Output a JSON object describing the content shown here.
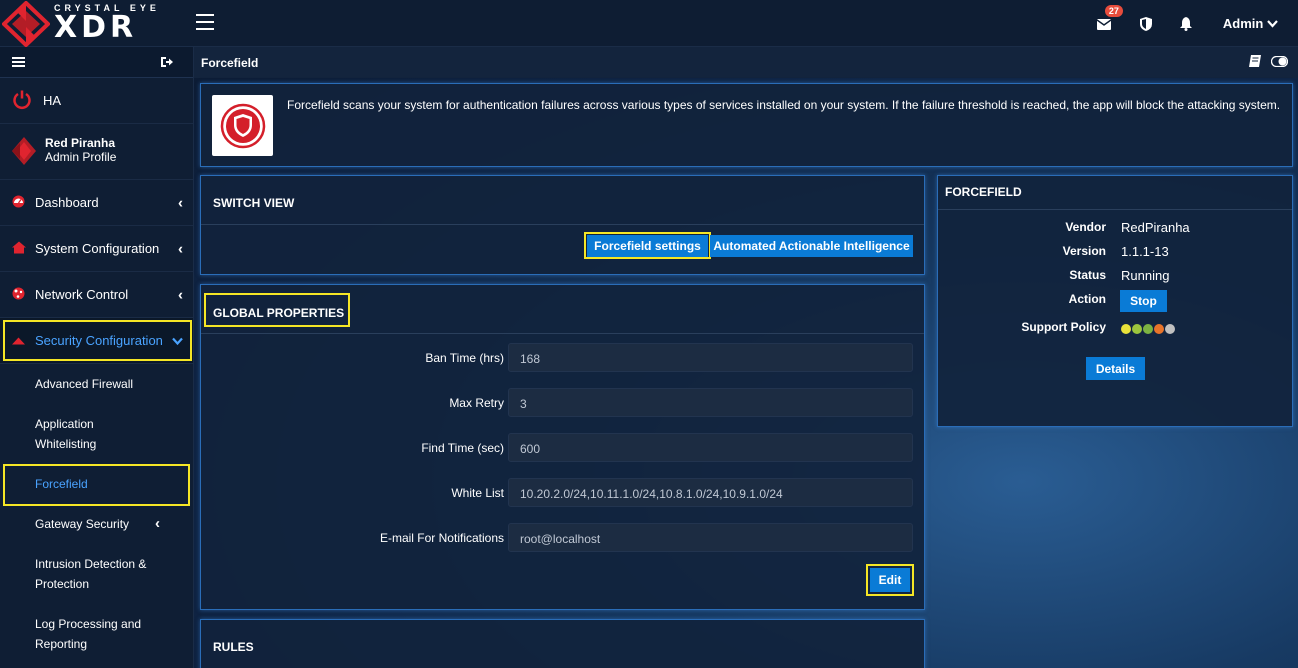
{
  "logo": {
    "top": "CRYSTAL EYE",
    "main": "XDR"
  },
  "topbar": {
    "mail_count": "27",
    "admin_label": "Admin"
  },
  "sidebar": {
    "ha_label": "HA",
    "profile_name": "Red Piranha",
    "profile_role": "Admin Profile",
    "items": [
      {
        "label": "Dashboard"
      },
      {
        "label": "System Configuration"
      },
      {
        "label": "Network Control"
      },
      {
        "label": "Security Configuration"
      }
    ],
    "sub_items": [
      {
        "label": "Advanced Firewall"
      },
      {
        "label": "Application Whitelisting"
      },
      {
        "label": "Forcefield"
      },
      {
        "label": "Gateway Security"
      },
      {
        "label": "Intrusion Detection & Protection"
      },
      {
        "label": "Log Processing and Reporting"
      }
    ]
  },
  "page": {
    "title": "Forcefield",
    "description": "Forcefield scans your system for authentication failures across various types of services installed on your system. If the failure threshold is reached, the app will block the attacking system."
  },
  "switch_view": {
    "title": "SWITCH VIEW",
    "btn_settings": "Forcefield settings",
    "btn_aai": "Automated Actionable Intelligence"
  },
  "global_properties": {
    "title": "GLOBAL PROPERTIES",
    "fields": [
      {
        "label": "Ban Time (hrs)",
        "value": "168"
      },
      {
        "label": "Max Retry",
        "value": "3"
      },
      {
        "label": "Find Time (sec)",
        "value": "600"
      },
      {
        "label": "White List",
        "value": "10.20.2.0/24,10.11.1.0/24,10.8.1.0/24,10.9.1.0/24"
      },
      {
        "label": "E-mail For Notifications",
        "value": "root@localhost"
      }
    ],
    "edit_label": "Edit"
  },
  "rules": {
    "title": "RULES"
  },
  "forcefield_info": {
    "title": "FORCEFIELD",
    "vendor_label": "Vendor",
    "vendor": "RedPiranha",
    "version_label": "Version",
    "version": "1.1.1-13",
    "status_label": "Status",
    "status": "Running",
    "action_label": "Action",
    "action_btn": "Stop",
    "support_label": "Support Policy",
    "support_colors": [
      "#e8e23a",
      "#9bc53d",
      "#7cb342",
      "#e8742a",
      "#c0c0c0"
    ],
    "details_btn": "Details"
  },
  "colors": {
    "accent": "#0a7bd6",
    "highlight": "#f5e625",
    "brand_red": "#e0242f"
  }
}
